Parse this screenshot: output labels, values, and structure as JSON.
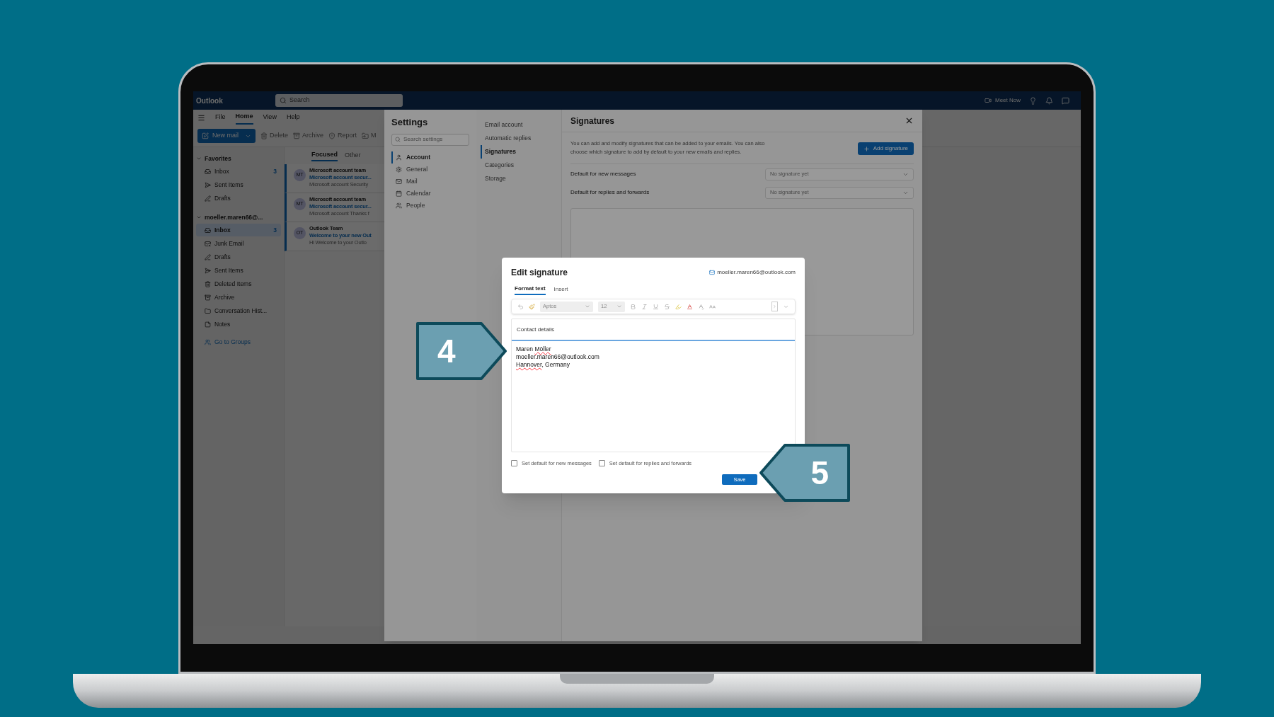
{
  "topbar": {
    "brand": "Outlook",
    "search": {
      "placeholder": "Search"
    },
    "meet_now": "Meet Now"
  },
  "menu": [
    {
      "label": "File",
      "selected": false
    },
    {
      "label": "Home",
      "selected": true
    },
    {
      "label": "View",
      "selected": false
    },
    {
      "label": "Help",
      "selected": false
    }
  ],
  "toolbar": [
    {
      "kind": "primary",
      "label": "New mail",
      "disabled": false
    },
    {
      "kind": "delete",
      "label": "Delete",
      "disabled": true
    },
    {
      "kind": "archive",
      "label": "Archive",
      "disabled": true
    },
    {
      "kind": "report",
      "label": "Report",
      "disabled": true
    },
    {
      "kind": "move",
      "label": "M",
      "disabled": true
    }
  ],
  "nav": [
    {
      "label": "Favorites",
      "expanded": true,
      "items": [
        {
          "kind": "inbox",
          "label": "Inbox",
          "count": "3",
          "selected": false
        },
        {
          "kind": "sent",
          "label": "Sent Items",
          "selected": false
        },
        {
          "kind": "drafts",
          "label": "Drafts",
          "selected": false
        }
      ]
    },
    {
      "label": "moeller.maren66@...",
      "expanded": true,
      "items": [
        {
          "kind": "inbox",
          "label": "Inbox",
          "count": "3",
          "selected": true
        },
        {
          "kind": "junk",
          "label": "Junk Email",
          "selected": false
        },
        {
          "kind": "drafts",
          "label": "Drafts",
          "selected": false
        },
        {
          "kind": "sent",
          "label": "Sent Items",
          "selected": false
        },
        {
          "kind": "deleted",
          "label": "Deleted Items",
          "selected": false
        },
        {
          "kind": "archive",
          "label": "Archive",
          "selected": false
        },
        {
          "kind": "folder",
          "label": "Conversation Hist...",
          "selected": false
        },
        {
          "kind": "notes",
          "label": "Notes",
          "selected": false
        }
      ]
    }
  ],
  "groups_link": "Go to Groups",
  "message_tabs": [
    {
      "label": "Focused",
      "selected": true
    },
    {
      "label": "Other",
      "selected": false
    }
  ],
  "messages": [
    {
      "initials": "MT",
      "sender": "Microsoft account team",
      "subject": "Microsoft account secur...",
      "preview": "Microsoft account Security",
      "unread": true
    },
    {
      "initials": "MT",
      "sender": "Microsoft account team",
      "subject": "Microsoft account secur...",
      "preview": "Microsoft account Thanks f",
      "unread": true
    },
    {
      "initials": "OT",
      "sender": "Outlook Team",
      "subject": "Welcome to your new Out",
      "preview": "Hi Welcome to your Outlo",
      "unread": true
    }
  ],
  "settings": {
    "title": "Settings",
    "search": {
      "placeholder": "Search settings"
    },
    "categories": [
      {
        "kind": "account",
        "label": "Account",
        "selected": true
      },
      {
        "kind": "general",
        "label": "General",
        "selected": false
      },
      {
        "kind": "mail",
        "label": "Mail",
        "selected": false
      },
      {
        "kind": "calendar",
        "label": "Calendar",
        "selected": false
      },
      {
        "kind": "people",
        "label": "People",
        "selected": false
      }
    ],
    "subnav": [
      {
        "label": "Email account",
        "selected": false
      },
      {
        "label": "Automatic replies",
        "selected": false
      },
      {
        "label": "Signatures",
        "selected": true
      },
      {
        "label": "Categories",
        "selected": false
      },
      {
        "label": "Storage",
        "selected": false
      }
    ],
    "page_title": "Signatures",
    "description": "You can add and modify signatures that can be added to your emails. You can also choose which signature to add by default to your new emails and replies.",
    "add_button": "Add signature",
    "defaults": [
      {
        "label": "Default for new messages",
        "placeholder": "No signature yet"
      },
      {
        "label": "Default for replies and forwards",
        "placeholder": "No signature yet"
      }
    ]
  },
  "dialog": {
    "title": "Edit signature",
    "account": "moeller.maren66@outlook.com",
    "tabs": [
      {
        "label": "Format text",
        "selected": true
      },
      {
        "label": "Insert",
        "selected": false
      }
    ],
    "font": "Aptos",
    "size": "12",
    "name_field": {
      "value": "Contact details"
    },
    "body": [
      [
        {
          "text": "Maren ",
          "misspelled": false
        },
        {
          "text": "Möller",
          "misspelled": true
        }
      ],
      [
        {
          "text": "moeller.maren66@outlook.com",
          "misspelled": false
        }
      ],
      [
        {
          "text": "Hannover",
          "misspelled": true
        },
        {
          "text": ", Germany",
          "misspelled": false
        }
      ]
    ],
    "checkboxes": [
      {
        "label": "Set default for new messages",
        "checked": false
      },
      {
        "label": "Set default for replies and forwards",
        "checked": false
      }
    ],
    "save": "Save"
  },
  "callouts": [
    {
      "label": "4",
      "kind": "right"
    },
    {
      "label": "5",
      "kind": "left"
    }
  ]
}
